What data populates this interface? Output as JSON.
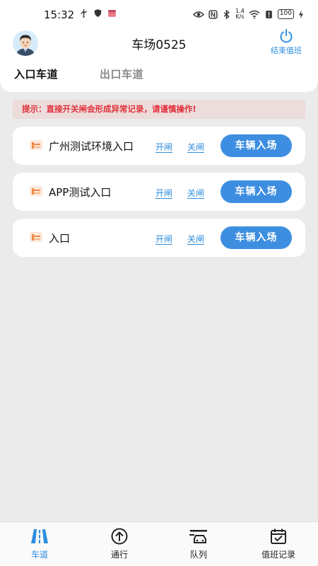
{
  "status_bar": {
    "time": "15:32",
    "network_speed": "1.4\nK/s",
    "battery": "100"
  },
  "header": {
    "title": "车场0525",
    "end_shift_label": "结束值班"
  },
  "tabs": [
    {
      "label": "入口车道",
      "active": true
    },
    {
      "label": "出口车道",
      "active": false
    }
  ],
  "warning": {
    "text": "提示：直接开关闸会形成异常记录，请谨慎操作!"
  },
  "lanes": [
    {
      "name": "广州测试环境入口",
      "open_label": "开闸",
      "close_label": "关闸",
      "action_label": "车辆入场"
    },
    {
      "name": "APP测试入口",
      "open_label": "开闸",
      "close_label": "关闸",
      "action_label": "车辆入场"
    },
    {
      "name": "入口",
      "open_label": "开闸",
      "close_label": "关闸",
      "action_label": "车辆入场"
    }
  ],
  "bottom_nav": [
    {
      "label": "车道",
      "icon": "road-icon",
      "active": true
    },
    {
      "label": "通行",
      "icon": "arrow-up-circle-icon",
      "active": false
    },
    {
      "label": "队列",
      "icon": "car-queue-icon",
      "active": false
    },
    {
      "label": "值班记录",
      "icon": "calendar-check-icon",
      "active": false
    }
  ],
  "colors": {
    "accent": "#3d8ee1",
    "warning_text": "#e0303a",
    "warning_bg": "#eddcdc",
    "background": "#ebebeb"
  }
}
